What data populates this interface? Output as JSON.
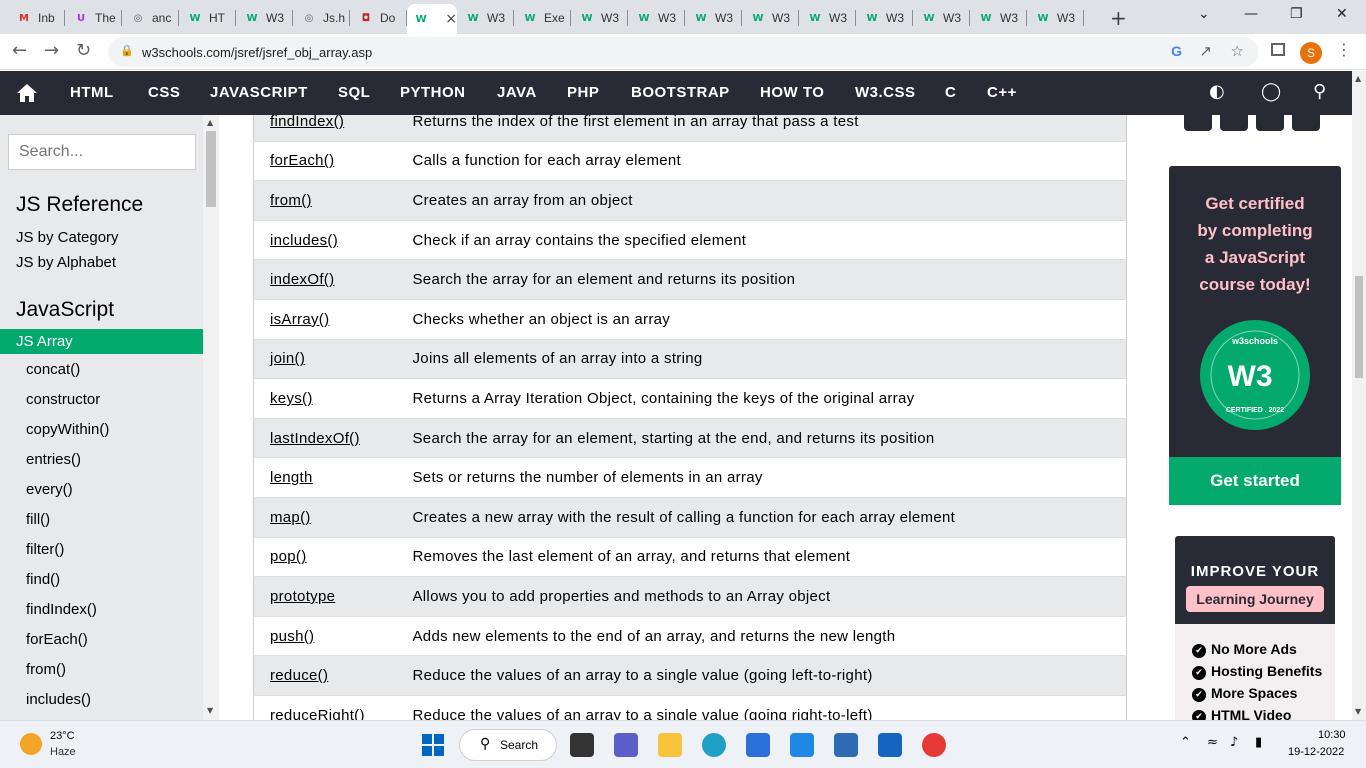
{
  "browser": {
    "tabs": [
      {
        "icon": "gmail-icon",
        "label": "Inb"
      },
      {
        "icon": "udemy-icon",
        "label": "The"
      },
      {
        "icon": "globe-icon",
        "label": "anc"
      },
      {
        "icon": "w3-icon",
        "label": "HT"
      },
      {
        "icon": "w3-icon",
        "label": "W3"
      },
      {
        "icon": "globe-icon",
        "label": "Js.h"
      },
      {
        "icon": "doc-icon",
        "label": "Do"
      },
      {
        "icon": "w3-icon",
        "label": ""
      },
      {
        "icon": "w3-icon",
        "label": "W3"
      },
      {
        "icon": "w3-icon",
        "label": "Exe"
      },
      {
        "icon": "w3-icon",
        "label": "W3"
      },
      {
        "icon": "w3-icon",
        "label": "W3"
      },
      {
        "icon": "w3-icon",
        "label": "W3"
      },
      {
        "icon": "w3-icon",
        "label": "W3"
      },
      {
        "icon": "w3-icon",
        "label": "W3"
      },
      {
        "icon": "w3-icon",
        "label": "W3"
      },
      {
        "icon": "w3-icon",
        "label": "W3"
      },
      {
        "icon": "w3-icon",
        "label": "W3"
      },
      {
        "icon": "w3-icon",
        "label": "W3"
      }
    ],
    "url": "w3schools.com/jsref/jsref_obj_array.asp",
    "profile_initial": "S"
  },
  "nav": {
    "links": [
      "HTML",
      "CSS",
      "JAVASCRIPT",
      "SQL",
      "PYTHON",
      "JAVA",
      "PHP",
      "BOOTSTRAP",
      "HOW TO",
      "W3.CSS",
      "C",
      "C++"
    ]
  },
  "sidebar": {
    "search_placeholder": "Search...",
    "ref_heading": "JS Reference",
    "ref_links": [
      "JS by Category",
      "JS by Alphabet"
    ],
    "js_heading": "JavaScript",
    "active_item": "JS Array",
    "methods": [
      "concat()",
      "constructor",
      "copyWithin()",
      "entries()",
      "every()",
      "fill()",
      "filter()",
      "find()",
      "findIndex()",
      "forEach()",
      "from()",
      "includes()"
    ]
  },
  "table": {
    "rows": [
      {
        "method": "findIndex()",
        "desc": "Returns the index of the first element in an array that pass a test"
      },
      {
        "method": "forEach()",
        "desc": "Calls a function for each array element"
      },
      {
        "method": "from()",
        "desc": "Creates an array from an object"
      },
      {
        "method": "includes()",
        "desc": "Check if an array contains the specified element"
      },
      {
        "method": "indexOf()",
        "desc": "Search the array for an element and returns its position"
      },
      {
        "method": "isArray()",
        "desc": "Checks whether an object is an array"
      },
      {
        "method": "join()",
        "desc": "Joins all elements of an array into a string"
      },
      {
        "method": "keys()",
        "desc": "Returns a Array Iteration Object, containing the keys of the original array"
      },
      {
        "method": "lastIndexOf()",
        "desc": "Search the array for an element, starting at the end, and returns its position"
      },
      {
        "method": "length",
        "desc": "Sets or returns the number of elements in an array"
      },
      {
        "method": "map()",
        "desc": "Creates a new array with the result of calling a function for each array element"
      },
      {
        "method": "pop()",
        "desc": "Removes the last element of an array, and returns that element"
      },
      {
        "method": "prototype",
        "desc": "Allows you to add properties and methods to an Array object"
      },
      {
        "method": "push()",
        "desc": "Adds new elements to the end of an array, and returns the new length"
      },
      {
        "method": "reduce()",
        "desc": "Reduce the values of an array to a single value (going left-to-right)"
      },
      {
        "method": "reduceRight()",
        "desc": "Reduce the values of an array to a single value (going right-to-left)"
      }
    ]
  },
  "ad": {
    "cert_lines": [
      "Get certified",
      "by completing",
      "a JavaScript",
      "course today!"
    ],
    "badge_top": "w3schools",
    "badge_mark": "W3",
    "badge_bottom": "CERTIFIED . 2022",
    "cta": "Get started",
    "improve_heading": "IMPROVE YOUR",
    "improve_pill": "Learning Journey",
    "features": [
      "No More Ads",
      "Hosting Benefits",
      "More Spaces",
      "HTML Video"
    ]
  },
  "taskbar": {
    "temp": "23°C",
    "weather": "Haze",
    "search_label": "Search",
    "time": "10:30",
    "date": "19-12-2022"
  },
  "colors": {
    "w3_green": "#04aa6d",
    "nav_dark": "#282a35",
    "pink": "#ffc0c7"
  }
}
